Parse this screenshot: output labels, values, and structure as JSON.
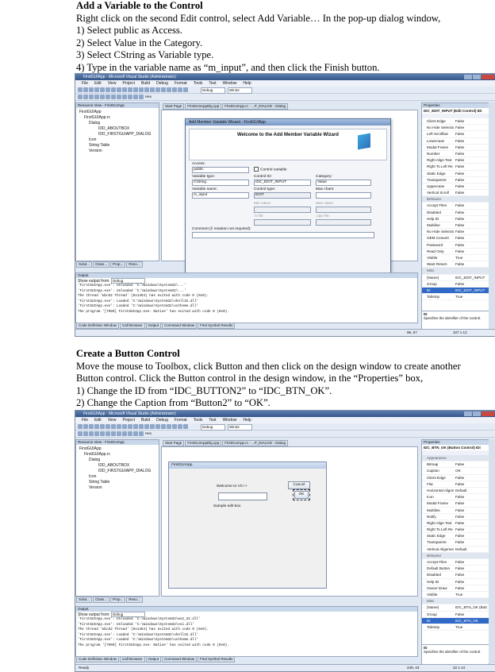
{
  "section1": {
    "heading": "Add a Variable to the Control",
    "intro": "Right click on the second Edit control, select Add Variable… In the pop-up dialog window,",
    "steps": [
      "1) Select public as Access.",
      "2) Select Value in the Category.",
      "3) Select CString as Variable type.",
      "4) Type in the variable name as “m_input”, and then click the Finish button."
    ]
  },
  "section2": {
    "heading": "Create a Button Control",
    "intro_1": "Move the mouse to Toolbox, click Button and then click on the design window to create another",
    "intro_2": "Button control. Click the Button control in the design window, in the “Properties” box,",
    "steps": [
      "1) Change the ID from “IDC_BUTTON2” to “IDC_BTN_OK”.",
      "2) Change the Caption from “Button2” to “OK”."
    ]
  },
  "ide": {
    "menu": [
      "File",
      "Edit",
      "View",
      "Project",
      "Build",
      "Debug",
      "Format",
      "Tools",
      "Test",
      "Window",
      "Help"
    ],
    "debug_combo": "Debug",
    "platform_combo": "Win32",
    "hex_label": "Hex",
    "resource_view_title": "Resource View - FirstGUIApp",
    "tree": [
      "FirstGUIApp",
      "FirstGUIApp.rc",
      "Dialog",
      "IDD_ABOUTBOX",
      "IDD_FIRSTGUIAPP_DIALOG",
      "Icon",
      "String Table",
      "Version"
    ],
    "bottom_tabs_left": [
      "Solut...",
      "Class...",
      "Prop...",
      "Reso..."
    ],
    "output_title": "Output",
    "output_show_label": "Show output from:",
    "output_source": "Debug",
    "properties_title": "Properties",
    "bottom_tabs_main": [
      "Code Definition Window",
      "Call Browser",
      "Output",
      "Command Window",
      "Find Symbol Results"
    ],
    "status_ready": "Ready"
  },
  "shot1": {
    "title": "FirstGUIApp - Microsoft Visual Studio (Administrator)",
    "doc_tabs": [
      "Start Page",
      "FirstGUIAppDlg.cpp",
      "FirstGUIApp.rc - ...P_DIALOG - Dialog"
    ],
    "wizard": {
      "title": "Add Member Variable Wizard - FirstGUIApp",
      "banner": "Welcome to the Add Member Variable Wizard",
      "access_label": "Access:",
      "access_value": "public",
      "control_var_label": "Control variable",
      "vartype_label": "Variable type:",
      "vartype_value": "CString",
      "controlid_label": "Control ID:",
      "controlid_value": "IDC_EDIT_INPUT",
      "category_label": "Category:",
      "category_value": "Value",
      "varname_label": "Variable name:",
      "varname_value": "m_input",
      "controltype_label": "Control type:",
      "controltype_value": "EDIT",
      "maxchars_label": "Max chars:",
      "minvalue_label": "Min value:",
      "maxvalue_label": "Max value:",
      "hfile_label": ".h file:",
      "cppfile_label": ".cpp file:",
      "comment_label": "Comment (// notation not required):",
      "finish": "Finish",
      "cancel": "Cancel"
    },
    "output_lines": [
      "'FirstGUIApp.exe': Unloaded 'C:\\Windows\\System32\\...'",
      "'FirstGUIApp.exe': Unloaded 'C:\\Windows\\System32\\...'",
      "The thread 'Win32 Thread' (0x1454) has exited with code 0 (0x0).",
      "'FirstGUIApp.exe': Loaded 'C:\\Windows\\System32\\shell32.dll'",
      "'FirstGUIApp.exe': Loaded 'C:\\Windows\\System32\\uxtheme.dll'",
      "The program '[7960] FirstGUIApp.exe: Native' has exited with code 0 (0x0)."
    ],
    "props_header": "IDC_EDIT_INPUT (Edit Control)  IDi",
    "props": [
      [
        "Client Edge",
        "False"
      ],
      [
        "No Hide Selection",
        "False"
      ],
      [
        "Left Scrollbar",
        "False"
      ],
      [
        "Lowercase",
        "False"
      ],
      [
        "Modal Frame",
        "False"
      ],
      [
        "Number",
        "False"
      ],
      [
        "Right Align Text",
        "False"
      ],
      [
        "Right To Left Re",
        "False"
      ],
      [
        "Static Edge",
        "False"
      ],
      [
        "Transparent",
        "False"
      ],
      [
        "Uppercase",
        "False"
      ],
      [
        "Vertical Scroll",
        "False"
      ],
      [
        "Behavior",
        ""
      ],
      [
        "Accept Files",
        "False"
      ],
      [
        "Disabled",
        "False"
      ],
      [
        "Help ID",
        "False"
      ],
      [
        "Multiline",
        "False"
      ],
      [
        "No Hide Selectio",
        "False"
      ],
      [
        "OEM Convert",
        "False"
      ],
      [
        "Password",
        "False"
      ],
      [
        "Read Only",
        "False"
      ],
      [
        "Visible",
        "True"
      ],
      [
        "Want Return",
        "False"
      ],
      [
        "Misc",
        ""
      ],
      [
        "(Name)",
        "IDC_EDIT_INPUT"
      ],
      [
        "Group",
        "False"
      ],
      [
        "ID",
        "IDC_EDIT_INPUT"
      ],
      [
        "Tabstop",
        "True"
      ]
    ],
    "props_desc_title": "ID",
    "props_desc": "Specifies the identifier of the control.",
    "status_pos": "96, 67",
    "status_size": "107 x 12"
  },
  "shot2": {
    "title": "FirstGUIApp - Microsoft Visual Studio (Administrator)",
    "doc_tabs": [
      "Start Page",
      "FirstGUIAppDlg.cpp",
      "FirstGUIApp.rc - ...P_DIALOG - Dialog"
    ],
    "dialog_title": "FirstGUIApp",
    "welcome_text": "Welcome to VC++",
    "cancel_btn": "Cancel",
    "ok_btn": "OK",
    "edit_sample": "Sample edit box",
    "output_lines": [
      "'FirstGUIApp.exe': Unloaded 'C:\\Windows\\System32\\ws2_32.dll'",
      "'FirstGUIApp.exe': Unloaded 'C:\\Windows\\System32\\nsi.dll'",
      "The thread 'Win32 Thread' (0x1454) has exited with code 0 (0x0).",
      "'FirstGUIApp.exe': Loaded 'C:\\Windows\\System32\\shell32.dll'",
      "'FirstGUIApp.exe': Loaded 'C:\\Windows\\System32\\uxtheme.dll'",
      "The program '[7960] FirstGUIApp.exe: Native' has exited with code 0 (0x0)."
    ],
    "props_header": "IDC_BTN_OK (Button Control)  IDi",
    "props": [
      [
        "Appearance",
        ""
      ],
      [
        "Bitmap",
        "False"
      ],
      [
        "Caption",
        "OK"
      ],
      [
        "Client Edge",
        "False"
      ],
      [
        "Flat",
        "False"
      ],
      [
        "Horizontal Alignment",
        "Default"
      ],
      [
        "Icon",
        "False"
      ],
      [
        "Modal Frame",
        "False"
      ],
      [
        "Multiline",
        "False"
      ],
      [
        "Notify",
        "False"
      ],
      [
        "Right Align Text",
        "False"
      ],
      [
        "Right To Left Re",
        "False"
      ],
      [
        "Static Edge",
        "False"
      ],
      [
        "Transparent",
        "False"
      ],
      [
        "Vertical Alignment",
        "Default"
      ],
      [
        "Behavior",
        ""
      ],
      [
        "Accept Files",
        "False"
      ],
      [
        "Default Button",
        "False"
      ],
      [
        "Disabled",
        "False"
      ],
      [
        "Help ID",
        "False"
      ],
      [
        "Owner Draw",
        "False"
      ],
      [
        "Visible",
        "True"
      ],
      [
        "Misc",
        ""
      ],
      [
        "(Name)",
        "IDC_BTN_OK (Butt"
      ],
      [
        "Group",
        "False"
      ],
      [
        "ID",
        "IDC_BTN_OK"
      ],
      [
        "Tabstop",
        "True"
      ]
    ],
    "props_desc_title": "ID",
    "props_desc": "Specifies the identifier of the control.",
    "status_pos": "249, 43",
    "status_size": "42 x 14"
  }
}
